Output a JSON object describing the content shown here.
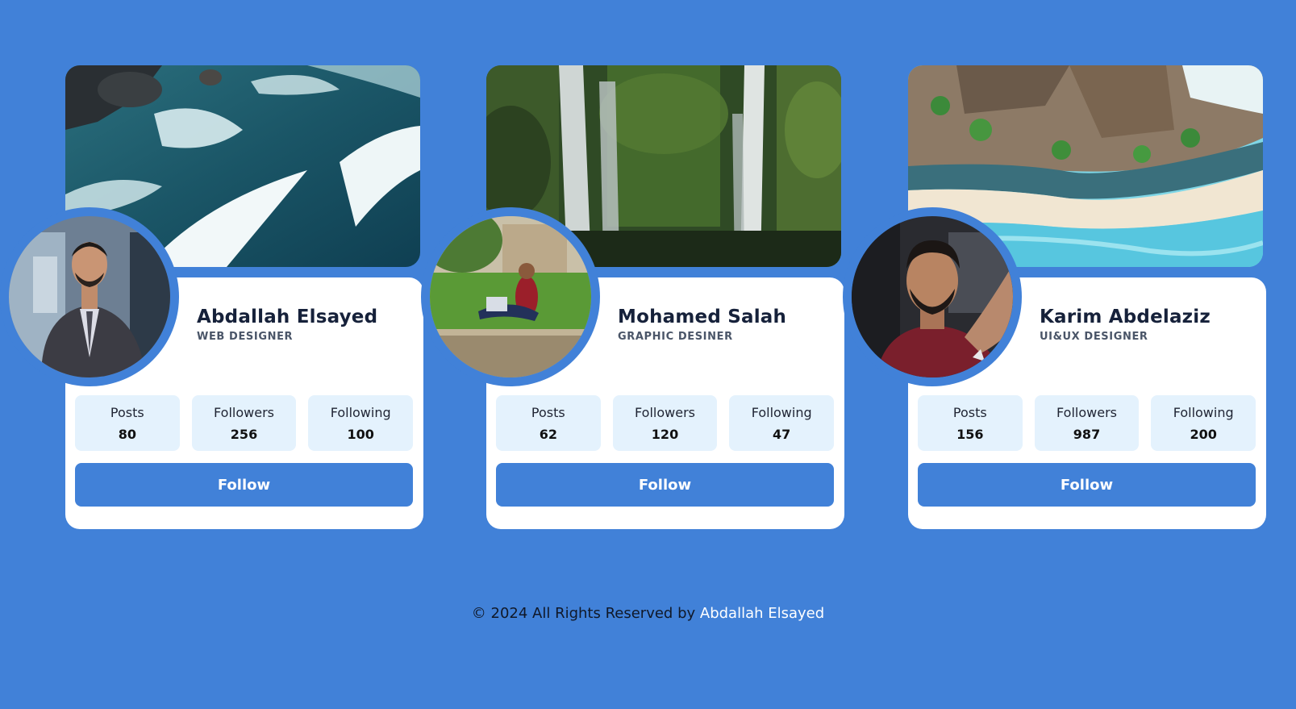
{
  "colors": {
    "background": "#4181d8",
    "card": "#ffffff",
    "stat_box": "#e4f2fd",
    "button": "#4181d8",
    "footer_link": "#ffffff"
  },
  "cards": [
    {
      "name": "Abdallah Elsayed",
      "role": "WEB DESIGNER",
      "cover": "ocean-waves-photo",
      "avatar": "man-in-suit-photo",
      "stats": [
        {
          "label": "Posts",
          "value": "80"
        },
        {
          "label": "Followers",
          "value": "256"
        },
        {
          "label": "Following",
          "value": "100"
        }
      ],
      "button": "Follow"
    },
    {
      "name": "Mohamed Salah",
      "role": "GRAPHIC DESINER",
      "cover": "waterfall-photo",
      "avatar": "man-sitting-on-grass-photo",
      "stats": [
        {
          "label": "Posts",
          "value": "62"
        },
        {
          "label": "Followers",
          "value": "120"
        },
        {
          "label": "Following",
          "value": "47"
        }
      ],
      "button": "Follow"
    },
    {
      "name": "Karim Abdelaziz",
      "role": "UI&UX DESIGNER",
      "cover": "beach-resort-photo",
      "avatar": "man-selfie-in-car-photo",
      "stats": [
        {
          "label": "Posts",
          "value": "156"
        },
        {
          "label": "Followers",
          "value": "987"
        },
        {
          "label": "Following",
          "value": "200"
        }
      ],
      "button": "Follow"
    }
  ],
  "footer": {
    "text": "© 2024 All Rights Reserved by ",
    "link": "Abdallah Elsayed"
  }
}
